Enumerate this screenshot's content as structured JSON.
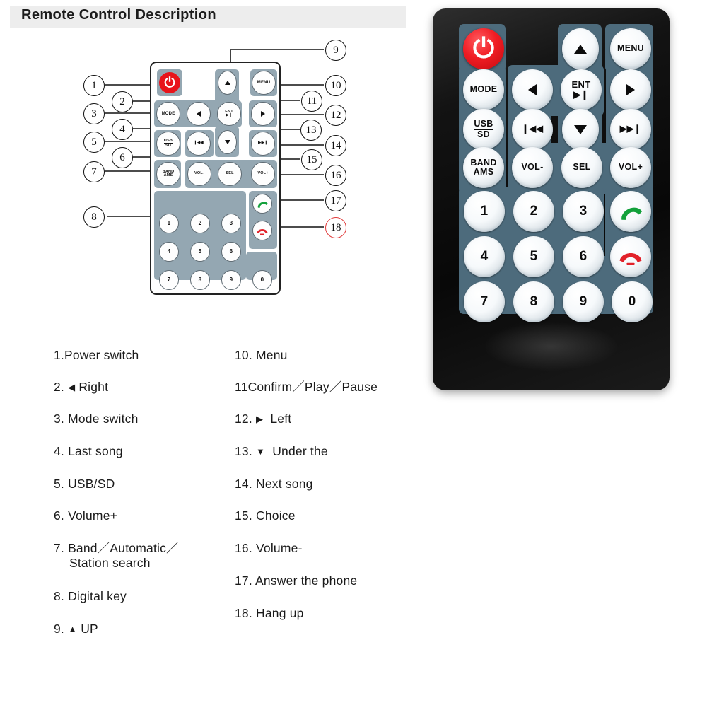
{
  "header": {
    "title": "Remote Control Description"
  },
  "diagram": {
    "name": "remote-control-line-diagram",
    "keys": {
      "power": "power-icon",
      "menu": "MENU",
      "mode": "MODE",
      "ent_line1": "ENT",
      "ent_line2": "▶❙",
      "usb_line1": "USB",
      "usb_line2": "SD",
      "band_line1": "BAND",
      "band_line2": "AMS",
      "prev": "❙◀◀",
      "next": "▶▶❙",
      "vol_down": "VOL-",
      "vol_up": "VOL+",
      "sel": "SEL",
      "up": "up-arrow-icon",
      "down": "down-arrow-icon",
      "left": "left-arrow-icon",
      "right": "right-arrow-icon",
      "answer": "answer-call-icon",
      "hangup": "hang-up-icon",
      "digits": [
        "1",
        "2",
        "3",
        "4",
        "5",
        "6",
        "7",
        "8",
        "9",
        "0"
      ]
    },
    "callouts": [
      {
        "n": "1",
        "accent": false
      },
      {
        "n": "2",
        "accent": false
      },
      {
        "n": "3",
        "accent": false
      },
      {
        "n": "4",
        "accent": false
      },
      {
        "n": "5",
        "accent": false
      },
      {
        "n": "6",
        "accent": false
      },
      {
        "n": "7",
        "accent": false
      },
      {
        "n": "8",
        "accent": false
      },
      {
        "n": "9",
        "accent": false
      },
      {
        "n": "10",
        "accent": false
      },
      {
        "n": "11",
        "accent": false
      },
      {
        "n": "12",
        "accent": false
      },
      {
        "n": "13",
        "accent": false
      },
      {
        "n": "14",
        "accent": false
      },
      {
        "n": "15",
        "accent": false
      },
      {
        "n": "16",
        "accent": false
      },
      {
        "n": "17",
        "accent": false
      },
      {
        "n": "18",
        "accent": true
      }
    ]
  },
  "photo": {
    "name": "remote-control-photograph",
    "keys": {
      "power": "power-icon",
      "menu": "MENU",
      "mode": "MODE",
      "ent_line1": "ENT",
      "ent_line2": "▶❙",
      "usb_line1": "USB",
      "usb_line2": "SD",
      "band_line1": "BAND",
      "band_line2": "AMS",
      "prev": "❙◀◀",
      "next": "▶▶❙",
      "vol_down": "VOL-",
      "vol_up": "VOL+",
      "sel": "SEL",
      "digits": [
        "1",
        "2",
        "3",
        "4",
        "5",
        "6",
        "7",
        "8",
        "9",
        "0"
      ]
    }
  },
  "legend": {
    "left": [
      {
        "num": "1.",
        "glyph": "",
        "text": "Power switch",
        "sub": ""
      },
      {
        "num": "2.",
        "glyph": "◀",
        "text": "Right",
        "sub": ""
      },
      {
        "num": "3.",
        "glyph": "",
        "text": "Mode switch",
        "sub": ""
      },
      {
        "num": "4.",
        "glyph": "",
        "text": "Last song",
        "sub": ""
      },
      {
        "num": "5.",
        "glyph": "",
        "text": "USB/SD",
        "sub": ""
      },
      {
        "num": "6.",
        "glyph": "",
        "text": "Volume+",
        "sub": ""
      },
      {
        "num": "7.",
        "glyph": "",
        "text": "Band／Automatic／",
        "sub": "Station search"
      },
      {
        "num": "8.",
        "glyph": "",
        "text": "Digital key",
        "sub": ""
      },
      {
        "num": "9.",
        "glyph": "▲",
        "text": "UP",
        "sub": ""
      }
    ],
    "right": [
      {
        "num": "10.",
        "glyph": "",
        "text": "Menu",
        "sub": ""
      },
      {
        "num": "11",
        "glyph": "",
        "text": "Confirm／Play／Pause",
        "sub": ""
      },
      {
        "num": "12.",
        "glyph": "▶",
        "text": "Left",
        "sub": ""
      },
      {
        "num": "13.",
        "glyph": "▼",
        "text": "Under the",
        "sub": ""
      },
      {
        "num": "14.",
        "glyph": "",
        "text": "Next song",
        "sub": ""
      },
      {
        "num": "15.",
        "glyph": "",
        "text": "Choice",
        "sub": ""
      },
      {
        "num": "16.",
        "glyph": "",
        "text": "Volume-",
        "sub": ""
      },
      {
        "num": "17.",
        "glyph": "",
        "text": "Answer the phone",
        "sub": ""
      },
      {
        "num": "18.",
        "glyph": "",
        "text": "Hang up",
        "sub": ""
      }
    ]
  },
  "colors": {
    "header_bg": "#ededed",
    "power_red": "#e8131a",
    "diagram_pad": "#94a7b2",
    "photo_pad": "#4d6b7c",
    "photo_body": "#0c0c0c",
    "answer_green": "#12a03a",
    "hangup_red": "#e2222a",
    "callout_accent": "#e03a3a"
  }
}
